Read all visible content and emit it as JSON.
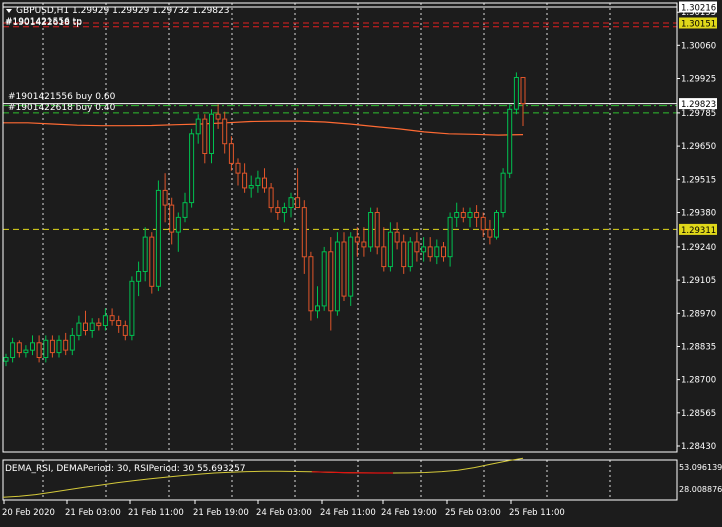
{
  "chart": {
    "symbol_line": "GBPUSD,H1  1.29929 1.29929 1.29732 1.29823",
    "marker_icon": "triangle-down-icon",
    "order_label_top": "#1901422618 tp",
    "order_label_top_overlap": "#1901421556 tp",
    "order_label_1": "#1901421556 buy 0.60",
    "order_label_2": "#1901422618 buy 0.40",
    "colors": {
      "background": "#1c1c1c",
      "grid": "#ffffff",
      "bull": "#00c050",
      "bear": "#e0552a",
      "ma": "#ff6a33",
      "dema": "#d4c93a",
      "rsi_red": "#e01010",
      "level_green": "#2ec02e",
      "level_red": "#e02020",
      "level_yellow": "#e0d81a"
    }
  },
  "price_axis": {
    "ticks": [
      "1.30195",
      "1.30060",
      "1.29925",
      "1.29785",
      "1.29650",
      "1.29515",
      "1.29380",
      "1.29240",
      "1.29105",
      "1.28970",
      "1.28835",
      "1.28700",
      "1.28565",
      "1.28430"
    ],
    "tags": [
      {
        "label": "1.30216",
        "style": "white"
      },
      {
        "label": "1.30151",
        "style": "yellow"
      },
      {
        "label": "1.29823",
        "style": "white"
      },
      {
        "label": "1.29311",
        "style": "yellow"
      }
    ]
  },
  "time_axis": {
    "labels": [
      "20 Feb 2020",
      "21 Feb 03:00",
      "21 Feb 11:00",
      "21 Feb 19:00",
      "24 Feb 03:00",
      "24 Feb 11:00",
      "24 Feb 19:00",
      "25 Feb 03:00",
      "25 Feb 11:00"
    ]
  },
  "indicator": {
    "label": "DEMA_RSI, DEMAPeriod: 30, RSIPeriod: 30  55.693257",
    "scale_top": "53.096139",
    "scale_bottom": "28.008876"
  },
  "chart_data": {
    "type": "candlestick",
    "symbol": "GBPUSD",
    "timeframe": "H1",
    "y_unit": "price",
    "ylim": [
      1.2843,
      1.30216
    ],
    "candles": [
      [
        1.28775,
        1.28805,
        1.28755,
        1.2879
      ],
      [
        1.2879,
        1.2887,
        1.2877,
        1.2885
      ],
      [
        1.2885,
        1.2886,
        1.2879,
        1.2881
      ],
      [
        1.2881,
        1.2884,
        1.2879,
        1.2882
      ],
      [
        1.2882,
        1.2888,
        1.288,
        1.2885
      ],
      [
        1.2885,
        1.2888,
        1.2877,
        1.2879
      ],
      [
        1.2879,
        1.2888,
        1.2877,
        1.2886
      ],
      [
        1.2886,
        1.2888,
        1.2879,
        1.2881
      ],
      [
        1.2881,
        1.2888,
        1.2879,
        1.2886
      ],
      [
        1.2886,
        1.2889,
        1.288,
        1.2882
      ],
      [
        1.2882,
        1.2891,
        1.288,
        1.2888
      ],
      [
        1.2888,
        1.2896,
        1.2886,
        1.2893
      ],
      [
        1.2893,
        1.2898,
        1.2888,
        1.289
      ],
      [
        1.289,
        1.2895,
        1.2887,
        1.2893
      ],
      [
        1.2893,
        1.2895,
        1.289,
        1.2892
      ],
      [
        1.2892,
        1.2899,
        1.289,
        1.2896
      ],
      [
        1.2896,
        1.2899,
        1.2892,
        1.2894
      ],
      [
        1.2894,
        1.2896,
        1.2889,
        1.2892
      ],
      [
        1.2892,
        1.2894,
        1.2886,
        1.2888
      ],
      [
        1.2888,
        1.2912,
        1.2886,
        1.291
      ],
      [
        1.291,
        1.2918,
        1.2904,
        1.2914
      ],
      [
        1.2914,
        1.2932,
        1.291,
        1.2928
      ],
      [
        1.2928,
        1.293,
        1.2905,
        1.2908
      ],
      [
        1.2908,
        1.2951,
        1.2906,
        1.2947
      ],
      [
        1.2947,
        1.2954,
        1.2934,
        1.2941
      ],
      [
        1.2941,
        1.2944,
        1.2925,
        1.293
      ],
      [
        1.293,
        1.2938,
        1.2922,
        1.2936
      ],
      [
        1.2936,
        1.2946,
        1.2934,
        1.2942
      ],
      [
        1.2942,
        1.2972,
        1.294,
        1.297
      ],
      [
        1.297,
        1.2978,
        1.2966,
        1.2976
      ],
      [
        1.2976,
        1.2978,
        1.2958,
        1.2962
      ],
      [
        1.2962,
        1.298,
        1.2958,
        1.2978
      ],
      [
        1.2978,
        1.2982,
        1.2972,
        1.2976
      ],
      [
        1.2976,
        1.2979,
        1.2962,
        1.2966
      ],
      [
        1.2966,
        1.2969,
        1.2955,
        1.2958
      ],
      [
        1.2958,
        1.296,
        1.2949,
        1.2954
      ],
      [
        1.2954,
        1.2958,
        1.2946,
        1.2948
      ],
      [
        1.2948,
        1.2953,
        1.2944,
        1.2949
      ],
      [
        1.2949,
        1.2955,
        1.2946,
        1.2952
      ],
      [
        1.2952,
        1.2956,
        1.2946,
        1.2948
      ],
      [
        1.2948,
        1.295,
        1.2938,
        1.294
      ],
      [
        1.294,
        1.2943,
        1.2935,
        1.2938
      ],
      [
        1.2938,
        1.2942,
        1.2934,
        1.294
      ],
      [
        1.294,
        1.2946,
        1.2936,
        1.2944
      ],
      [
        1.2944,
        1.2956,
        1.2942,
        1.294
      ],
      [
        1.294,
        1.2943,
        1.2913,
        1.292
      ],
      [
        1.292,
        1.2922,
        1.2894,
        1.2898
      ],
      [
        1.2898,
        1.2908,
        1.2895,
        1.29
      ],
      [
        1.29,
        1.2924,
        1.2898,
        1.2922
      ],
      [
        1.2922,
        1.2928,
        1.289,
        1.2898
      ],
      [
        1.2898,
        1.293,
        1.2896,
        1.2926
      ],
      [
        1.2926,
        1.293,
        1.2902,
        1.2904
      ],
      [
        1.2904,
        1.293,
        1.29,
        1.2928
      ],
      [
        1.2928,
        1.2932,
        1.292,
        1.2926
      ],
      [
        1.2926,
        1.2932,
        1.292,
        1.2924
      ],
      [
        1.2924,
        1.294,
        1.2922,
        1.2938
      ],
      [
        1.2938,
        1.294,
        1.2921,
        1.2924
      ],
      [
        1.2924,
        1.2932,
        1.2914,
        1.2916
      ],
      [
        1.2916,
        1.2934,
        1.2914,
        1.293
      ],
      [
        1.293,
        1.2934,
        1.2923,
        1.2926
      ],
      [
        1.2926,
        1.2929,
        1.2913,
        1.2916
      ],
      [
        1.2916,
        1.2928,
        1.2914,
        1.2926
      ],
      [
        1.2926,
        1.293,
        1.2918,
        1.2922
      ],
      [
        1.2922,
        1.2928,
        1.2918,
        1.2924
      ],
      [
        1.2924,
        1.2928,
        1.2918,
        1.292
      ],
      [
        1.292,
        1.2927,
        1.2917,
        1.2924
      ],
      [
        1.2924,
        1.2926,
        1.2918,
        1.292
      ],
      [
        1.292,
        1.2938,
        1.2916,
        1.2936
      ],
      [
        1.2936,
        1.2942,
        1.2932,
        1.2938
      ],
      [
        1.2938,
        1.294,
        1.2934,
        1.2936
      ],
      [
        1.2936,
        1.294,
        1.2932,
        1.2938
      ],
      [
        1.2938,
        1.2941,
        1.2932,
        1.2936
      ],
      [
        1.2936,
        1.2938,
        1.2928,
        1.2931
      ],
      [
        1.2931,
        1.2935,
        1.2925,
        1.2928
      ],
      [
        1.2928,
        1.2939,
        1.2927,
        1.2938
      ],
      [
        1.2938,
        1.2956,
        1.2936,
        1.2954
      ],
      [
        1.2954,
        1.2982,
        1.2952,
        1.298
      ],
      [
        1.298,
        1.2995,
        1.2978,
        1.29929
      ],
      [
        1.29929,
        1.29929,
        1.29732,
        1.29823
      ]
    ],
    "moving_average": [
      1.29745,
      1.29745,
      1.2974,
      1.29735,
      1.29733,
      1.29733,
      1.29734,
      1.29737,
      1.2974,
      1.29745,
      1.2975,
      1.29752,
      1.29752,
      1.29748,
      1.2974,
      1.2973,
      1.2972,
      1.29708,
      1.297,
      1.29698,
      1.29695,
      1.29697
    ],
    "levels": [
      {
        "price": 1.30216,
        "style": "solid",
        "color": "white",
        "label": "1.30216"
      },
      {
        "price": 1.30151,
        "style": "dashed",
        "color": "red",
        "label": "1.30151"
      },
      {
        "price": 1.30136,
        "style": "dashed",
        "color": "red"
      },
      {
        "price": 1.29823,
        "style": "solid",
        "color": "white",
        "label": "1.29823"
      },
      {
        "price": 1.29815,
        "style": "dash-dot",
        "color": "green"
      },
      {
        "price": 1.29785,
        "style": "dashed",
        "color": "green"
      },
      {
        "price": 1.29311,
        "style": "dashed",
        "color": "yellow",
        "label": "1.29311"
      }
    ],
    "indicator_series": {
      "name": "DEMA_RSI",
      "ylim": [
        28.008876,
        53.096139
      ],
      "values": [
        28.5,
        29.2,
        30.4,
        32.0,
        33.8,
        35.5,
        37.0,
        38.6,
        40.0,
        41.3,
        42.5,
        43.6,
        44.6,
        45.4,
        46.0,
        46.4,
        46.6,
        46.6,
        46.5,
        46.3,
        46.0,
        45.7,
        45.5,
        45.4,
        45.4,
        45.5,
        45.8,
        46.4,
        47.4,
        49.2,
        51.5,
        53.8,
        55.7
      ],
      "red_segment_indices": [
        19,
        24
      ]
    }
  }
}
